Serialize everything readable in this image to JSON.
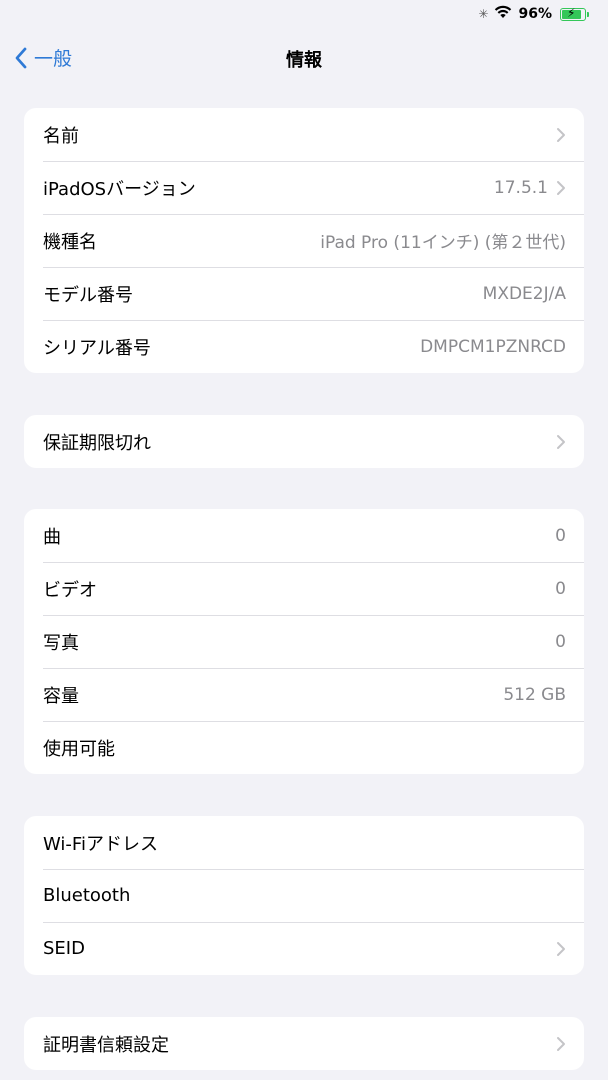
{
  "status_bar": {
    "battery_percent": "96%",
    "battery_level": 0.96
  },
  "nav": {
    "back_label": "一般",
    "title": "情報"
  },
  "groups": [
    {
      "rows": [
        {
          "label": "名前",
          "value": "",
          "chevron": true
        },
        {
          "label": "iPadOSバージョン",
          "value": "17.5.1",
          "chevron": true
        },
        {
          "label": "機種名",
          "value": "iPad Pro (11インチ) (第２世代)",
          "chevron": false
        },
        {
          "label": "モデル番号",
          "value": "MXDE2J/A",
          "chevron": false
        },
        {
          "label": "シリアル番号",
          "value": "DMPCM1PZNRCD",
          "chevron": false
        }
      ]
    },
    {
      "rows": [
        {
          "label": "保証期限切れ",
          "value": "",
          "chevron": true
        }
      ]
    },
    {
      "rows": [
        {
          "label": "曲",
          "value": "0",
          "chevron": false
        },
        {
          "label": "ビデオ",
          "value": "0",
          "chevron": false
        },
        {
          "label": "写真",
          "value": "0",
          "chevron": false
        },
        {
          "label": "容量",
          "value": "512 GB",
          "chevron": false
        },
        {
          "label": "使用可能",
          "value": "",
          "chevron": false
        }
      ]
    },
    {
      "rows": [
        {
          "label": "Wi-Fiアドレス",
          "value": "",
          "chevron": false
        },
        {
          "label": "Bluetooth",
          "value": "",
          "chevron": false
        },
        {
          "label": "SEID",
          "value": "",
          "chevron": true
        }
      ]
    },
    {
      "rows": [
        {
          "label": "証明書信頼設定",
          "value": "",
          "chevron": true
        }
      ]
    }
  ],
  "icons": {
    "back": "chevron-left-icon",
    "disclosure": "chevron-right-icon",
    "wifi": "wifi-icon",
    "battery": "battery-charging-icon",
    "activity": "activity-spinner-icon"
  },
  "colors": {
    "accent": "#2f7ad6",
    "background": "#f2f2f7",
    "battery": "#34c759",
    "secondary_text": "#8a8a8e"
  }
}
